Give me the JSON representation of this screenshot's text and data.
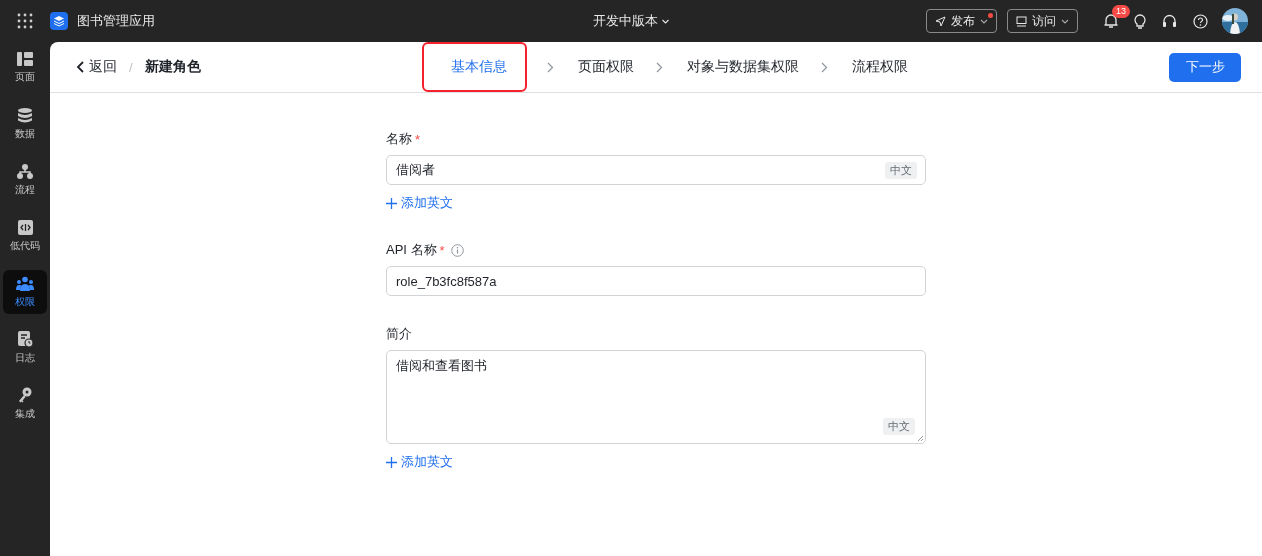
{
  "topbar": {
    "app_title": "图书管理应用",
    "version": "开发中版本",
    "publish": {
      "label": "发布",
      "has_dot": true
    },
    "visit": {
      "label": "访问"
    },
    "notifications": "13"
  },
  "sidebar": {
    "items": [
      {
        "label": "页面",
        "selected": false
      },
      {
        "label": "数据",
        "selected": false
      },
      {
        "label": "流程",
        "selected": false
      },
      {
        "label": "低代码",
        "selected": false
      },
      {
        "label": "权限",
        "selected": true
      },
      {
        "label": "日志",
        "selected": false
      },
      {
        "label": "集成",
        "selected": false
      }
    ]
  },
  "header": {
    "back": "返回",
    "separator": "/",
    "title": "新建角色",
    "steps": [
      {
        "label": "基本信息",
        "selected": true
      },
      {
        "label": "页面权限",
        "selected": false
      },
      {
        "label": "对象与数据集权限",
        "selected": false
      },
      {
        "label": "流程权限",
        "selected": false
      }
    ],
    "next": "下一步"
  },
  "form": {
    "fields": [
      {
        "kind": "input",
        "label": "名称",
        "required_mark": "*",
        "value": "借阅者",
        "lang_tag": "中文",
        "add_link": "添加英文"
      },
      {
        "kind": "input",
        "label": "API 名称",
        "required_mark": "*",
        "info": true,
        "value": "role_7b3fc8f587a"
      },
      {
        "kind": "textarea",
        "label": "简介",
        "value": "借阅和查看图书",
        "lang_tag": "中文",
        "add_link": "添加英文"
      }
    ]
  }
}
